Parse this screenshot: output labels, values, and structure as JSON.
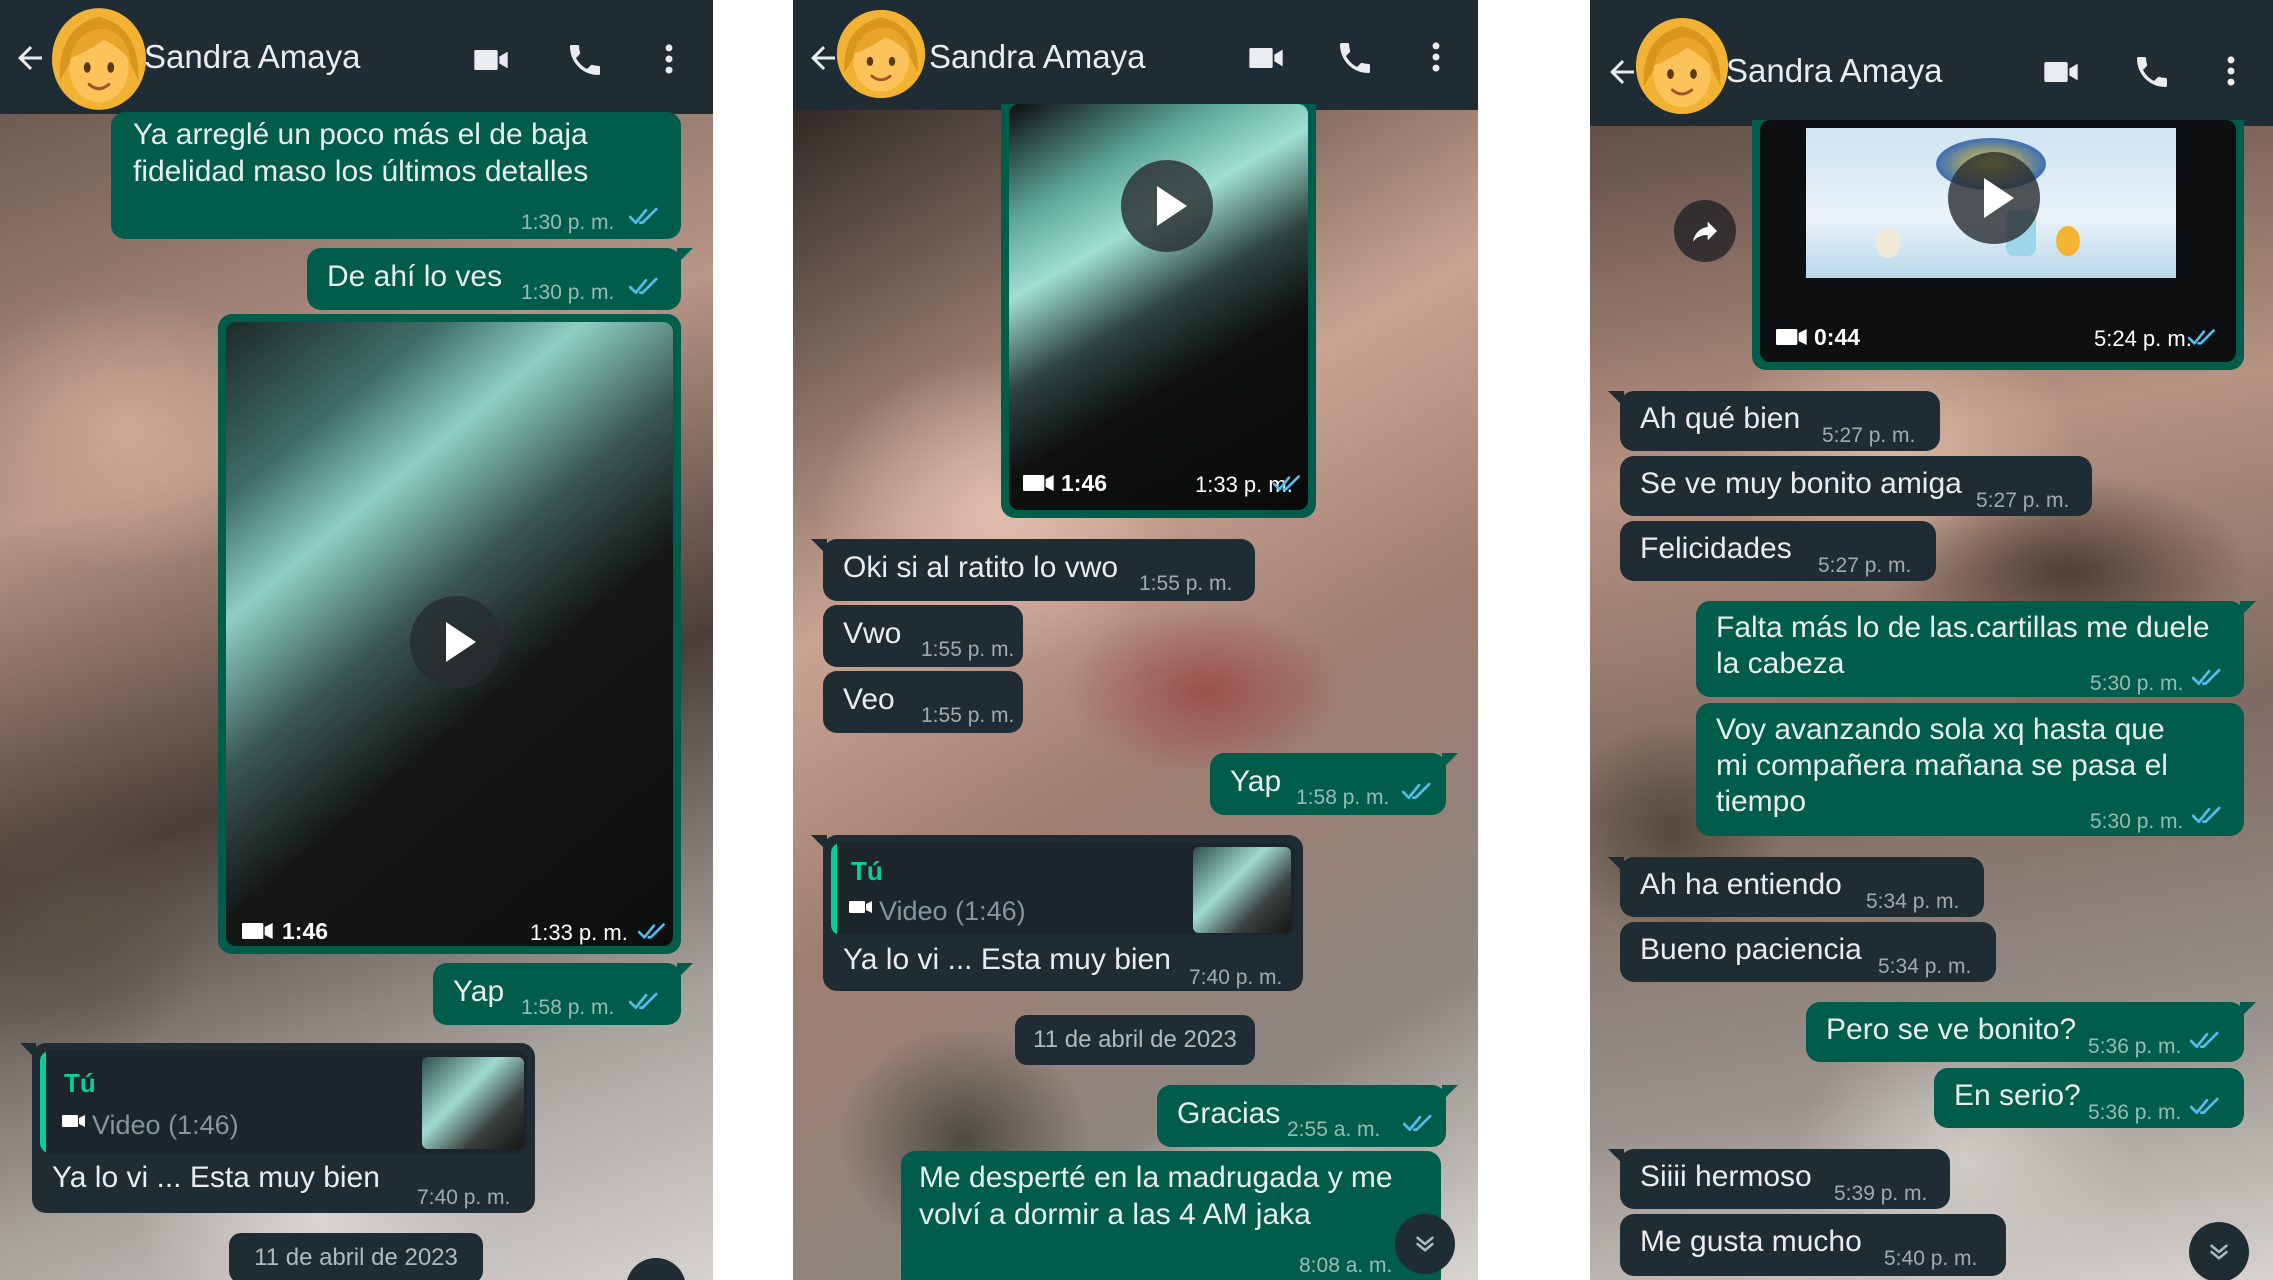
{
  "contact": {
    "name": "Sandra Amaya"
  },
  "colors": {
    "header": "#1f2c33",
    "outgoing": "#005c4b",
    "incoming": "#1f2c33",
    "tick_read": "#53bdeb",
    "quote_accent": "#06cf9c"
  },
  "icons": [
    "back-arrow-icon",
    "video-call-icon",
    "phone-icon",
    "more-options-icon",
    "double-check-icon",
    "play-icon",
    "video-camera-icon",
    "forward-icon",
    "scroll-down-icon"
  ],
  "panel1": {
    "messages": [
      {
        "text": "Ya arreglé un poco más el de baja",
        "text2": "fidelidad maso los últimos detalles",
        "time": "1:30 p. m."
      },
      {
        "text": "De ahí lo ves",
        "time": "1:30 p. m."
      },
      {
        "duration": "1:46",
        "time": "1:33 p. m."
      },
      {
        "text": "Yap",
        "time": "1:58 p. m."
      },
      {
        "quote_author": "Tú",
        "quote_desc": "Video (1:46)",
        "text": "Ya lo vi ... Esta muy bien",
        "time": "7:40 p. m."
      }
    ],
    "date": "11 de abril de 2023"
  },
  "panel2": {
    "messages": [
      {
        "duration": "1:46",
        "time": "1:33 p. m."
      },
      {
        "text": "Oki si al ratito lo vwo",
        "time": "1:55 p. m."
      },
      {
        "text": "Vwo",
        "time": "1:55 p. m."
      },
      {
        "text": "Veo",
        "time": "1:55 p. m."
      },
      {
        "text": "Yap",
        "time": "1:58 p. m."
      },
      {
        "quote_author": "Tú",
        "quote_desc": "Video (1:46)",
        "text": "Ya lo vi ... Esta muy bien",
        "time": "7:40 p. m."
      },
      {
        "text": "Gracias",
        "time": "2:55 a. m."
      },
      {
        "text": "Me desperté en la madrugada y me",
        "text2": "volví a dormir a las 4 AM jaka",
        "time": "8:08 a. m."
      }
    ],
    "date": "11 de abril de 2023"
  },
  "panel3": {
    "messages": [
      {
        "duration": "0:44",
        "time": "5:24 p. m."
      },
      {
        "text": "Ah qué bien",
        "time": "5:27 p. m."
      },
      {
        "text": "Se ve muy bonito amiga",
        "time": "5:27 p. m."
      },
      {
        "text": "Felicidades",
        "time": "5:27 p. m."
      },
      {
        "text": "Falta más lo de las.cartillas me duele",
        "text2": "la cabeza",
        "time": "5:30 p. m."
      },
      {
        "text": "Voy avanzando sola xq hasta que",
        "text2": "mi compañera mañana se pasa el",
        "text3": "tiempo",
        "time": "5:30 p. m."
      },
      {
        "text": "Ah ha entiendo",
        "time": "5:34 p. m."
      },
      {
        "text": "Bueno paciencia",
        "time": "5:34 p. m."
      },
      {
        "text": "Pero se ve bonito?",
        "time": "5:36 p. m."
      },
      {
        "text": "En serio?",
        "time": "5:36 p. m."
      },
      {
        "text": "Siiii hermoso",
        "time": "5:39 p. m."
      },
      {
        "text": "Me gusta mucho",
        "time": "5:40 p. m."
      }
    ]
  }
}
